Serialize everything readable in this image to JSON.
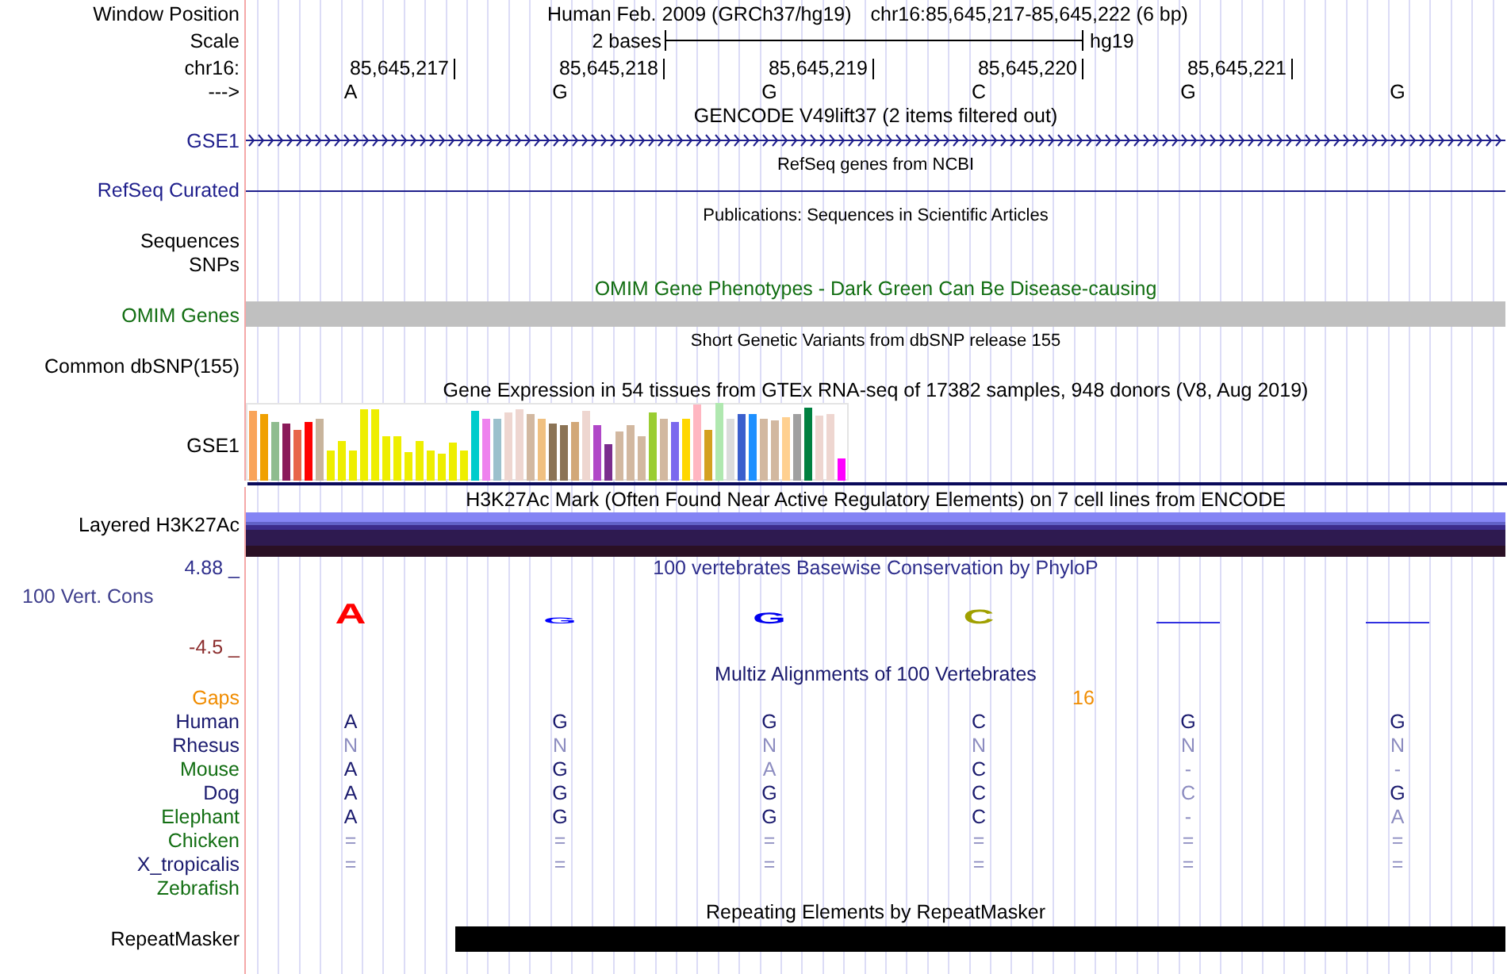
{
  "header": {
    "label": "Window Position",
    "assembly": "Human Feb. 2009 (GRCh37/hg19)",
    "position": "chr16:85,645,217-85,645,222 (6 bp)"
  },
  "scale": {
    "label": "Scale",
    "length": "2 bases",
    "assembly": "hg19"
  },
  "ruler": {
    "label": "chr16:",
    "positions": [
      "85,645,217",
      "85,645,218",
      "85,645,219",
      "85,645,220",
      "85,645,221"
    ]
  },
  "sequence": {
    "label": "--->",
    "bases": [
      "A",
      "G",
      "G",
      "C",
      "G",
      "G"
    ]
  },
  "tracks": [
    {
      "kind": "arrows",
      "title": "GENCODE V49lift37 (2 items filtered out)",
      "color": "#000000",
      "labels": [
        {
          "text": "GSE1",
          "color": "#1f1f8c"
        }
      ]
    },
    {
      "kind": "line",
      "title": "RefSeq genes from NCBI",
      "color": "#000000",
      "labels": [
        {
          "text": "RefSeq Curated",
          "color": "#1f1f8c"
        }
      ]
    },
    {
      "kind": "empty",
      "title": "Publications: Sequences in Scientific Articles",
      "color": "#000000",
      "labels": [
        {
          "text": "Sequences",
          "color": "#000000"
        },
        {
          "text": "SNPs",
          "color": "#000000"
        }
      ]
    },
    {
      "kind": "bar",
      "title": "OMIM Gene Phenotypes - Dark Green Can Be Disease-causing",
      "color": "#126e12",
      "labels": [
        {
          "text": "OMIM Genes",
          "color": "#126e12"
        }
      ]
    },
    {
      "kind": "empty",
      "title": "Short Genetic Variants from dbSNP release 155",
      "color": "#000000",
      "labels": [
        {
          "text": "Common dbSNP(155)",
          "color": "#000000"
        }
      ]
    },
    {
      "kind": "expression",
      "title": "Gene Expression in 54 tissues from GTEx RNA-seq of 17382 samples, 948 donors (V8, Aug 2019)",
      "color": "#000000",
      "labels": [
        {
          "text": "GSE1",
          "color": "#000000"
        }
      ]
    },
    {
      "kind": "layered",
      "title": "H3K27Ac Mark (Often Found Near Active Regulatory Elements) on 7 cell lines from ENCODE",
      "color": "#000000",
      "labels": [
        {
          "text": "Layered H3K27Ac",
          "color": "#000000"
        }
      ]
    },
    {
      "kind": "phylop",
      "title": "100 vertebrates Basewise Conservation by PhyloP",
      "color": "#2e2e8c",
      "logo": [
        "A",
        "G",
        "G",
        "C"
      ],
      "labels": [
        {
          "text": "4.88 _",
          "color": "#2e2e8c"
        },
        {
          "text": "100 Vert. Cons",
          "color": "#3e3e8c"
        },
        {
          "text": "-4.5 _",
          "color": "#8c2e2e"
        }
      ]
    },
    {
      "kind": "multiz",
      "title": "Multiz Alignments of 100 Vertebrates",
      "color": "#1a1a6e",
      "gaps": {
        "label": "Gaps",
        "value": "16",
        "color": "#f08c00"
      },
      "species": [
        {
          "name": "Human",
          "color": "#1a1a6e",
          "bases": [
            {
              "text": "A",
              "faded": false
            },
            {
              "text": "G",
              "faded": false
            },
            {
              "text": "G",
              "faded": false
            },
            {
              "text": "C",
              "faded": false
            },
            {
              "text": "G",
              "faded": false
            },
            {
              "text": "G",
              "faded": false
            }
          ]
        },
        {
          "name": "Rhesus",
          "color": "#1a1a6e",
          "bases": [
            {
              "text": "N",
              "faded": true
            },
            {
              "text": "N",
              "faded": true
            },
            {
              "text": "N",
              "faded": true
            },
            {
              "text": "N",
              "faded": true
            },
            {
              "text": "N",
              "faded": true
            },
            {
              "text": "N",
              "faded": true
            }
          ]
        },
        {
          "name": "Mouse",
          "color": "#126e12",
          "bases": [
            {
              "text": "A",
              "faded": false
            },
            {
              "text": "G",
              "faded": false
            },
            {
              "text": "A",
              "faded": true
            },
            {
              "text": "C",
              "faded": false
            },
            {
              "text": "-",
              "faded": true
            },
            {
              "text": "-",
              "faded": true
            }
          ]
        },
        {
          "name": "Dog",
          "color": "#1a1a6e",
          "bases": [
            {
              "text": "A",
              "faded": false
            },
            {
              "text": "G",
              "faded": false
            },
            {
              "text": "G",
              "faded": false
            },
            {
              "text": "C",
              "faded": false
            },
            {
              "text": "C",
              "faded": true
            },
            {
              "text": "G",
              "faded": false
            }
          ]
        },
        {
          "name": "Elephant",
          "color": "#126e12",
          "bases": [
            {
              "text": "A",
              "faded": false
            },
            {
              "text": "G",
              "faded": false
            },
            {
              "text": "G",
              "faded": false
            },
            {
              "text": "C",
              "faded": false
            },
            {
              "text": "-",
              "faded": true
            },
            {
              "text": "A",
              "faded": true
            }
          ]
        },
        {
          "name": "Chicken",
          "color": "#126e12",
          "bases": [
            {
              "text": "=",
              "faded": true
            },
            {
              "text": "=",
              "faded": true
            },
            {
              "text": "=",
              "faded": true
            },
            {
              "text": "=",
              "faded": true
            },
            {
              "text": "=",
              "faded": true
            },
            {
              "text": "=",
              "faded": true
            }
          ]
        },
        {
          "name": "X_tropicalis",
          "color": "#1a1a6e",
          "bases": [
            {
              "text": "=",
              "faded": true
            },
            {
              "text": "=",
              "faded": true
            },
            {
              "text": "=",
              "faded": true
            },
            {
              "text": "=",
              "faded": true
            },
            {
              "text": "=",
              "faded": true
            },
            {
              "text": "=",
              "faded": true
            }
          ]
        },
        {
          "name": "Zebrafish",
          "color": "#126e12"
        }
      ]
    },
    {
      "kind": "repeat",
      "title": "Repeating Elements by RepeatMasker",
      "color": "#000000",
      "labels": [
        {
          "text": "RepeatMasker",
          "color": "#000000"
        }
      ]
    }
  ]
}
